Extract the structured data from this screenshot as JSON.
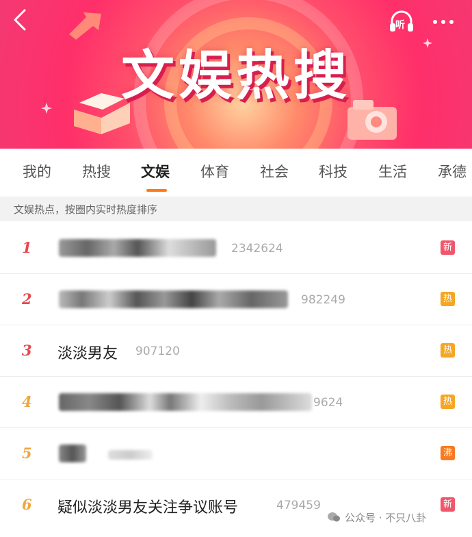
{
  "header": {
    "title": "文娱热搜",
    "listen_label": "听"
  },
  "tabs": [
    {
      "label": "我的"
    },
    {
      "label": "热搜"
    },
    {
      "label": "文娱"
    },
    {
      "label": "体育"
    },
    {
      "label": "社会"
    },
    {
      "label": "科技"
    },
    {
      "label": "生活"
    },
    {
      "label": "承德"
    }
  ],
  "subheader": "文娱热点，按圈内实时热度排序",
  "items": [
    {
      "rank": "1",
      "title": "",
      "count": "2342624",
      "badge": "新",
      "badge_color": "#f0576c"
    },
    {
      "rank": "2",
      "title": "",
      "count": "982249",
      "badge": "热",
      "badge_color": "#f5a623"
    },
    {
      "rank": "3",
      "title": "淡淡男友",
      "count": "907120",
      "badge": "热",
      "badge_color": "#f5a623"
    },
    {
      "rank": "4",
      "title": "",
      "count": "9624",
      "badge": "热",
      "badge_color": "#f5a623"
    },
    {
      "rank": "5",
      "title": "",
      "count": "",
      "badge": "沸",
      "badge_color": "#f77b22"
    },
    {
      "rank": "6",
      "title": "疑似淡淡男友关注争议账号",
      "count": "479459",
      "badge": "新",
      "badge_color": "#f0576c"
    }
  ],
  "watermark": "公众号 · 不只八卦",
  "colors": {
    "rank_top": "#e8474f",
    "rank_other": "#f0a640",
    "accent": "#ff7a1a"
  }
}
